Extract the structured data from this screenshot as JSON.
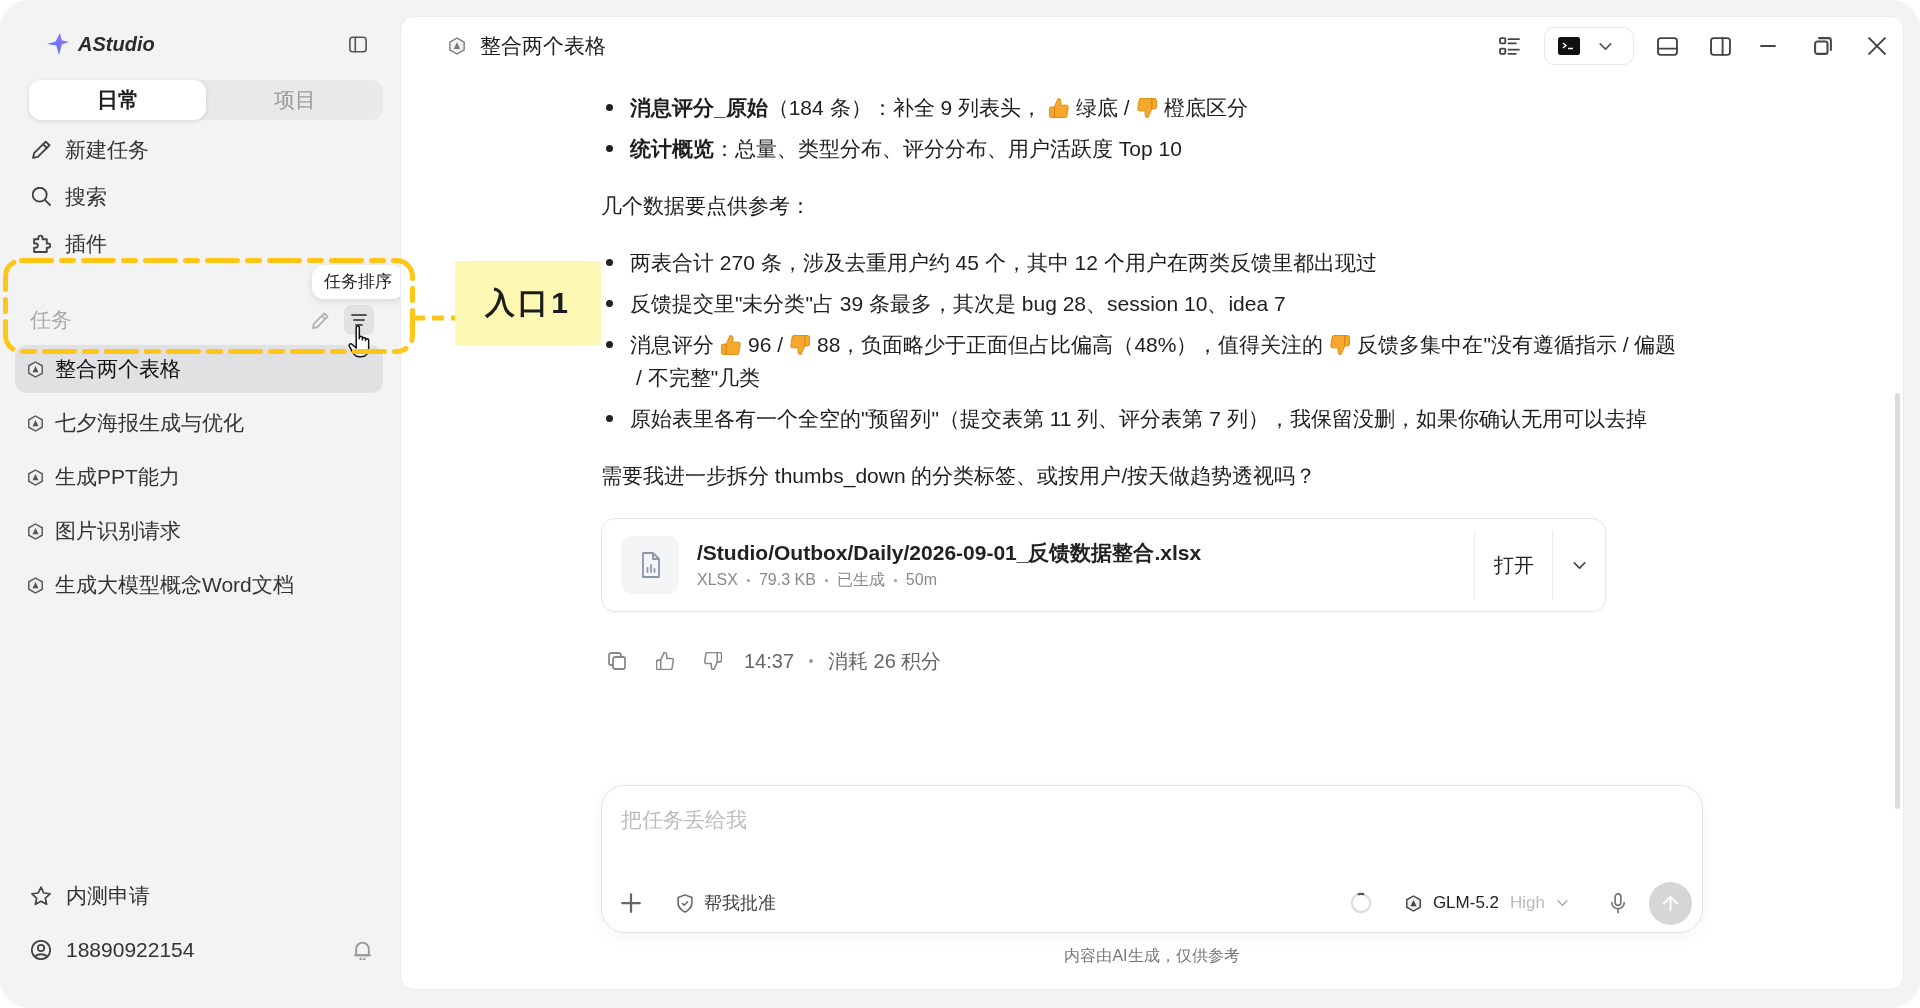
{
  "sidebar": {
    "brand": "AStudio",
    "tabs": [
      {
        "label": "日常",
        "selected": true
      },
      {
        "label": "项目",
        "selected": false
      }
    ],
    "nav": [
      {
        "kind": "new",
        "label": "新建任务"
      },
      {
        "kind": "search",
        "label": "搜索"
      },
      {
        "kind": "plugins",
        "label": "插件"
      }
    ],
    "tasks_section": {
      "title": "任务",
      "tooltip": "任务排序",
      "sort_hovered": true
    },
    "tasks": [
      {
        "title": "整合两个表格",
        "selected": true
      },
      {
        "title": "七夕海报生成与优化",
        "selected": false
      },
      {
        "title": "生成PPT能力",
        "selected": false
      },
      {
        "title": "图片识别请求",
        "selected": false
      },
      {
        "title": "生成大模型概念Word文档",
        "selected": false
      }
    ],
    "beta_label": "内测申请",
    "account": "18890922154"
  },
  "annotation": {
    "label": "入口1"
  },
  "conversation": {
    "title": "整合两个表格",
    "blocks": [
      {
        "kind": "list",
        "items": [
          {
            "parts": [
              {
                "kind": "text",
                "text": "**消息评分_原始**（184 条）：补全 9 列表头，"
              },
              {
                "kind": "thumbs_up"
              },
              {
                "kind": "text",
                "text": "绿底 /"
              },
              {
                "kind": "thumbs_down"
              },
              {
                "kind": "text",
                "text": "橙底区分"
              }
            ]
          },
          {
            "parts": [
              {
                "kind": "text",
                "text": "**统计概览**：总量、类型分布、评分分布、用户活跃度 Top 10"
              }
            ]
          }
        ]
      },
      {
        "kind": "paragraph",
        "text": "几个数据要点供参考："
      },
      {
        "kind": "list",
        "items": [
          {
            "parts": [
              {
                "kind": "text",
                "text": "两表合计 270 条，涉及去重用户约 45 个，其中 12 个用户在两类反馈里都出现过"
              }
            ]
          },
          {
            "parts": [
              {
                "kind": "text",
                "text": "反馈提交里\"未分类\"占 39 条最多，其次是 bug 28、session 10、idea 7"
              }
            ]
          },
          {
            "parts": [
              {
                "kind": "text",
                "text": "消息评分"
              },
              {
                "kind": "thumbs_up"
              },
              {
                "kind": "text",
                "text": "96 /"
              },
              {
                "kind": "thumbs_down"
              },
              {
                "kind": "text",
                "text": "88，负面略少于正面但占比偏高（48%），值得关注的"
              },
              {
                "kind": "thumbs_down"
              },
              {
                "kind": "text",
                "text": "反馈多集中在\"没有遵循指示 / 偏题"
              },
              {
                "kind": "text",
                "text": "/ 不完整\"几类"
              }
            ]
          },
          {
            "parts": [
              {
                "kind": "text",
                "text": "原始表里各有一个全空的\"预留列\"（提交表第 11 列、评分表第 7 列），我保留没删，如果你确认无用可以去掉"
              }
            ]
          }
        ]
      },
      {
        "kind": "paragraph",
        "text": "需要我进一步拆分 thumbs_down 的分类标签、或按用户/按天做趋势透视吗？"
      }
    ],
    "attachment": {
      "path": "/Studio/Outbox/Daily/2026-09-01_反馈数据整合.xlsx",
      "meta": [
        "XLSX",
        "79.3 KB",
        "已生成",
        "50m"
      ],
      "open_label": "打开"
    },
    "message_info": {
      "time": "14:37",
      "cost": "消耗 26 积分"
    }
  },
  "composer": {
    "placeholder": "把任务丢给我",
    "approve_label": "帮我批准",
    "model": "GLM-5.2",
    "effort": "High",
    "send_disabled": true
  },
  "footer_note": "内容由AI生成，仅供参考"
}
